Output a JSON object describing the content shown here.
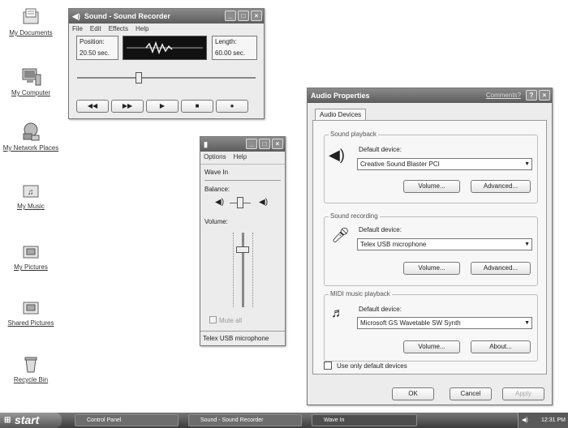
{
  "desktop": {
    "icons": [
      {
        "label": "My Documents",
        "icon": "documents-folder-icon"
      },
      {
        "label": "My Computer",
        "icon": "computer-icon"
      },
      {
        "label": "My Network Places",
        "icon": "network-icon"
      },
      {
        "label": "My Music",
        "icon": "music-folder-icon"
      },
      {
        "label": "My Pictures",
        "icon": "pictures-folder-icon"
      },
      {
        "label": "Shared Pictures",
        "icon": "pictures-folder-icon"
      },
      {
        "label": "Recycle Bin",
        "icon": "recycle-bin-icon"
      }
    ]
  },
  "recorder": {
    "title": "Sound - Sound Recorder",
    "menu": [
      "File",
      "Edit",
      "Effects",
      "Help"
    ],
    "position_label": "Position:",
    "position_value": "20.50 sec.",
    "length_label": "Length:",
    "length_value": "60.00 sec.",
    "seek_fraction": 0.34,
    "controls": [
      "◀◀",
      "▶▶",
      "▶",
      "■",
      "●"
    ]
  },
  "wavein": {
    "title": "",
    "menu": [
      "Options",
      "Help"
    ],
    "channel": "Wave In",
    "balance_label": "Balance:",
    "volume_label": "Volume:",
    "volume_level": 0.8,
    "mute_label": "Mute all",
    "device_label": "Telex USB microphone"
  },
  "audio": {
    "title": "Audio Properties",
    "help_link": "Comments?",
    "tab": "Audio Devices",
    "playback": {
      "group": "Sound playback",
      "label": "Default device:",
      "device": "Creative Sound Blaster PCI",
      "btn1": "Volume...",
      "btn2": "Advanced..."
    },
    "recording": {
      "group": "Sound recording",
      "label": "Default device:",
      "device": "Telex USB microphone",
      "btn1": "Volume...",
      "btn2": "Advanced..."
    },
    "midi": {
      "group": "MIDI music playback",
      "label": "Default device:",
      "device": "Microsoft GS Wavetable SW Synth",
      "btn1": "Volume...",
      "btn2": "About..."
    },
    "only_default": "Use only default devices",
    "ok": "OK",
    "cancel": "Cancel",
    "apply": "Apply"
  },
  "taskbar": {
    "start": "start",
    "tasks": [
      "Control Panel",
      "Sound - Sound Recorder",
      "Wave In"
    ],
    "clock": "12:31 PM"
  }
}
